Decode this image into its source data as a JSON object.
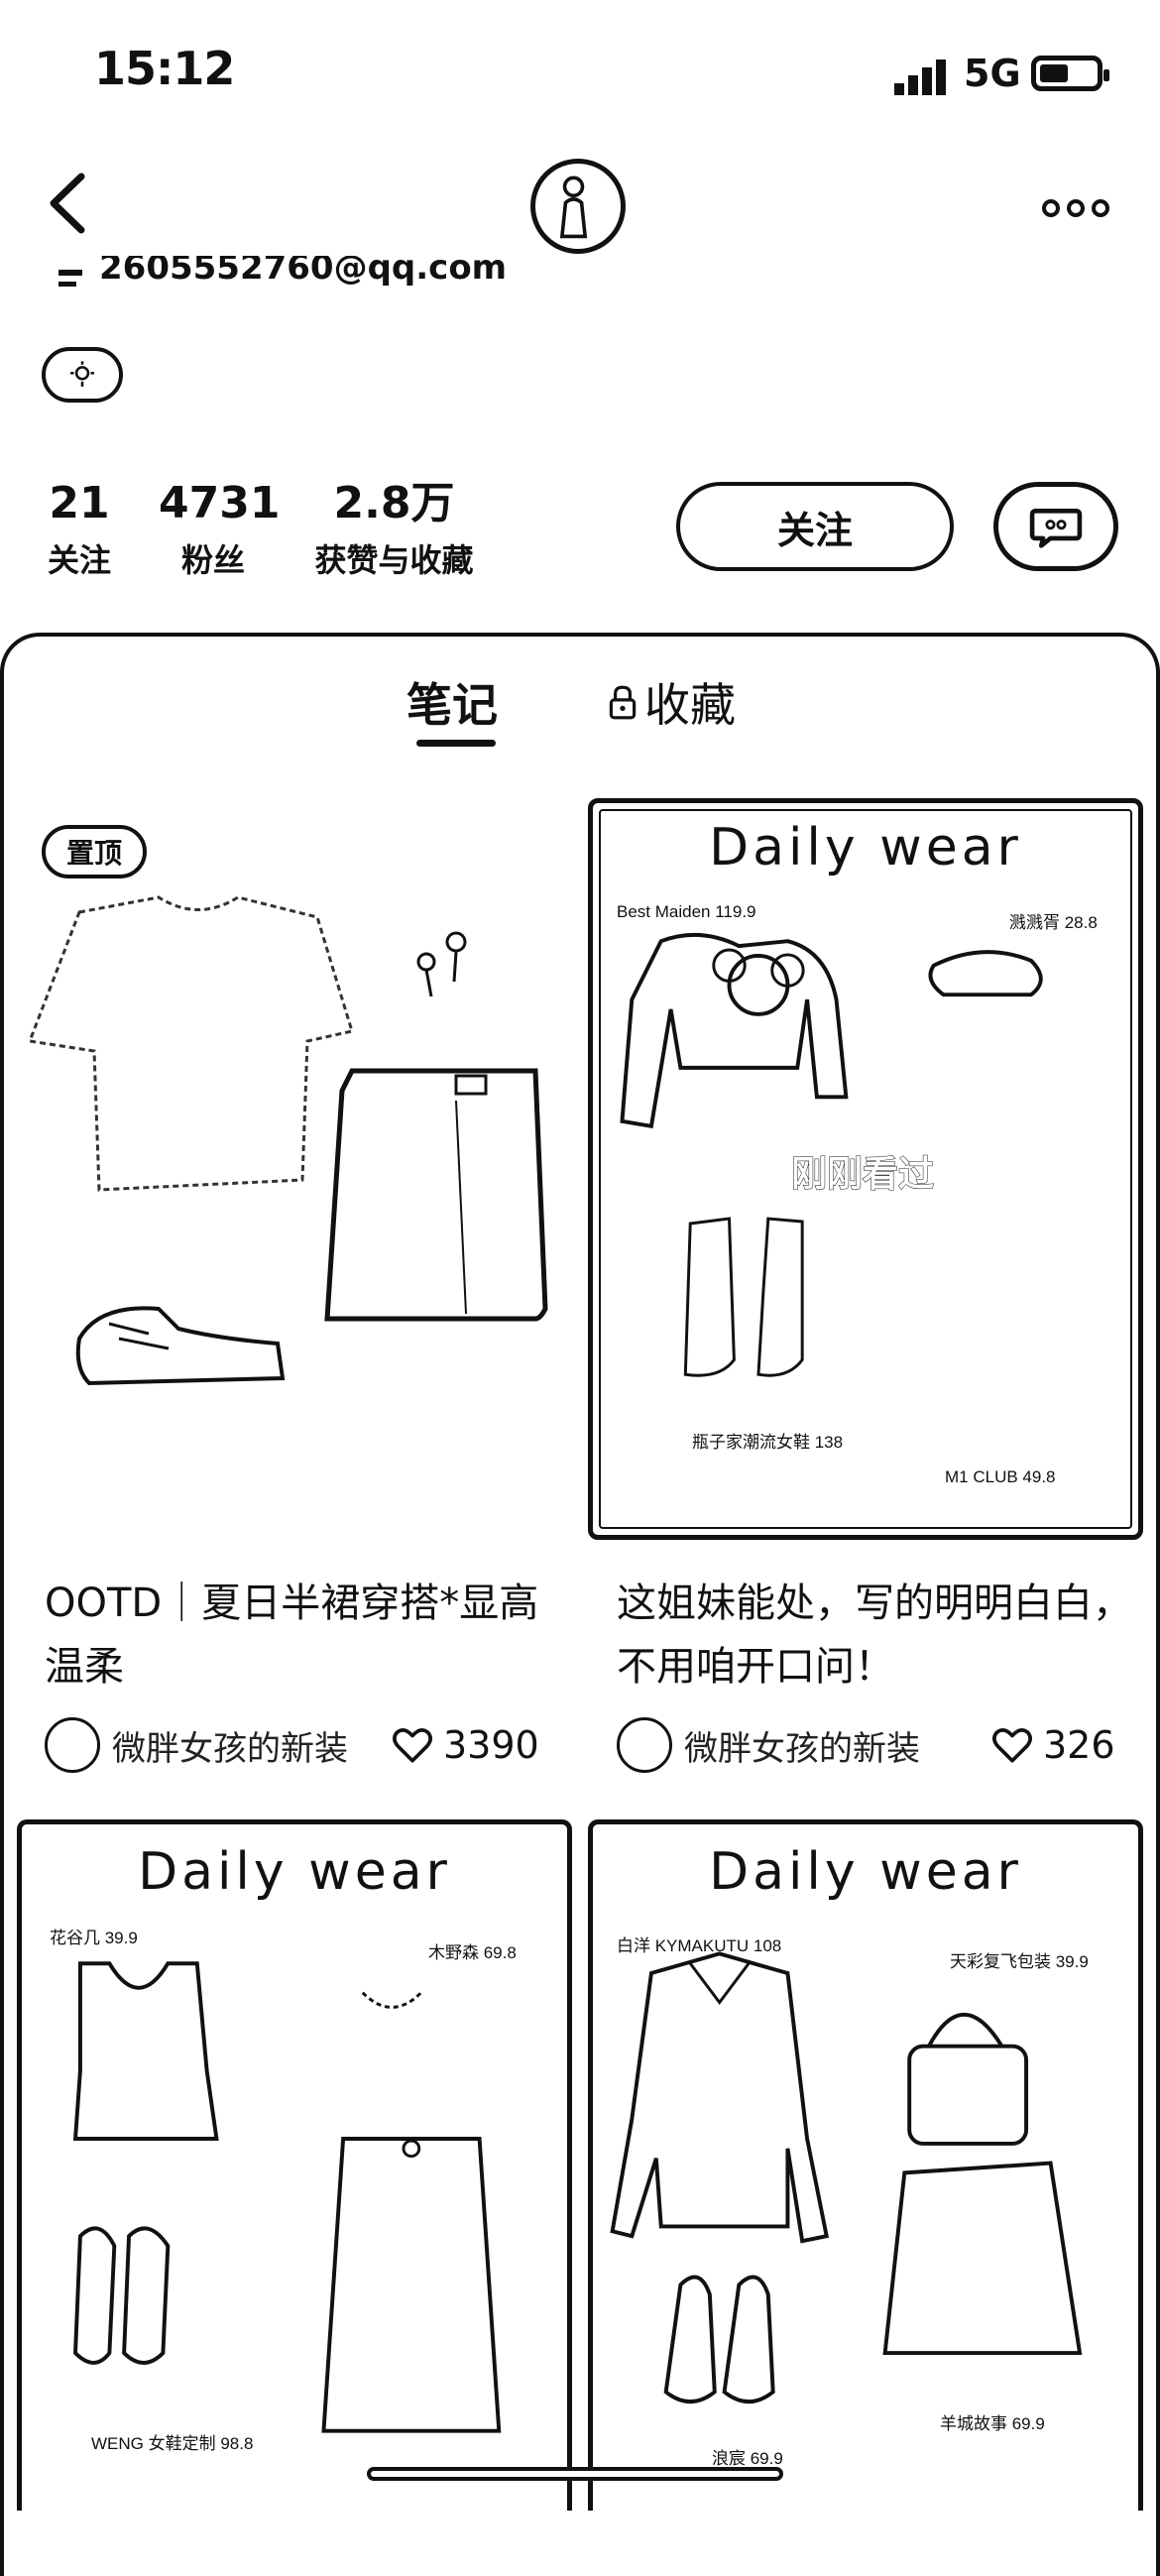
{
  "status_bar": {
    "time": "15:12",
    "network": "5G"
  },
  "profile": {
    "email": "2605552760@qq.com",
    "stats": [
      {
        "value": "21",
        "label": "关注"
      },
      {
        "value": "4731",
        "label": "粉丝"
      },
      {
        "value": "2.8万",
        "label": "获赞与收藏"
      }
    ],
    "follow_label": "关注"
  },
  "tabs": [
    {
      "label": "笔记",
      "active": true
    },
    {
      "label": "收藏",
      "locked": true
    }
  ],
  "notes": [
    {
      "badge": "置顶",
      "title": "OOTD｜夏日半裙穿搭*显高温柔",
      "author": "微胖女孩的新装",
      "likes": "3390"
    },
    {
      "image_title": "Daily wear",
      "items": [
        "Best Maiden 119.9",
        "溅溅胥 28.8",
        "瓶子家潮流女鞋 138",
        "M1 CLUB 49.8"
      ],
      "overlay": "刚刚看过",
      "title": "这姐妹能处，写的明明白白，不用咱开口问！",
      "author": "微胖女孩的新装",
      "likes": "326"
    },
    {
      "image_title": "Daily wear",
      "items": [
        "花谷几 39.9",
        "木野森 69.8",
        "WENG 女鞋定制 98.8"
      ]
    },
    {
      "image_title": "Daily wear",
      "items": [
        "白洋 KYMAKUTU 108",
        "天彩复飞包装 39.9",
        "浪宸 69.9",
        "羊城故事 69.9"
      ]
    }
  ]
}
